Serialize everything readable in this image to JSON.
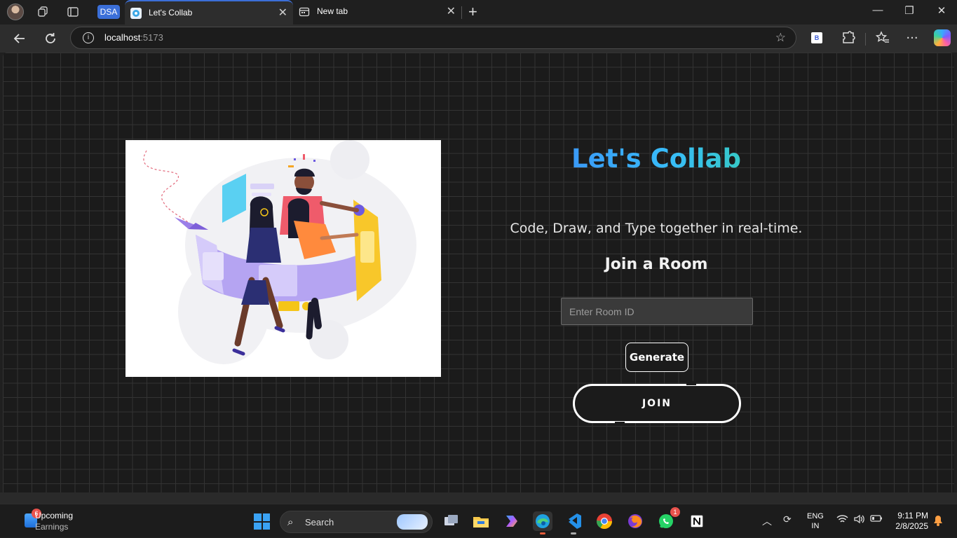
{
  "browser": {
    "tab_group_label": "DSA",
    "tabs": [
      {
        "title": "Let's Collab",
        "active": true
      },
      {
        "title": "New tab",
        "active": false
      }
    ],
    "new_tab_symbol": "+",
    "url_host": "localhost",
    "url_port": ":5173",
    "extension_label": "B",
    "icons": [
      "profile-avatar",
      "workspaces-icon",
      "tab-actions-icon",
      "back-icon",
      "refresh-icon",
      "info-icon",
      "favorite-star-icon",
      "extensions-icon",
      "favorites-icon",
      "more-icon",
      "copilot-icon"
    ]
  },
  "page": {
    "brand": "Let's Collab",
    "tagline": "Code, Draw, and Type together in real-time.",
    "join_heading": "Join a Room",
    "room_input": {
      "placeholder": "Enter Room ID",
      "value": ""
    },
    "generate_label": "Generate",
    "join_label": "JOIN",
    "brand_gradient": [
      "#3b82f6",
      "#38bdf8",
      "#34d399"
    ]
  },
  "taskbar": {
    "widget": {
      "badge": "6",
      "title": "Upcoming",
      "subtitle": "Earnings"
    },
    "search_label": "Search",
    "apps": [
      "task-view",
      "file-explorer",
      "copilot",
      "edge",
      "vscode",
      "chrome",
      "firefox",
      "whatsapp",
      "notion"
    ],
    "whatsapp_badge": "1",
    "language": {
      "line1": "ENG",
      "line2": "IN"
    },
    "time": "9:11 PM",
    "date": "2/8/2025"
  }
}
